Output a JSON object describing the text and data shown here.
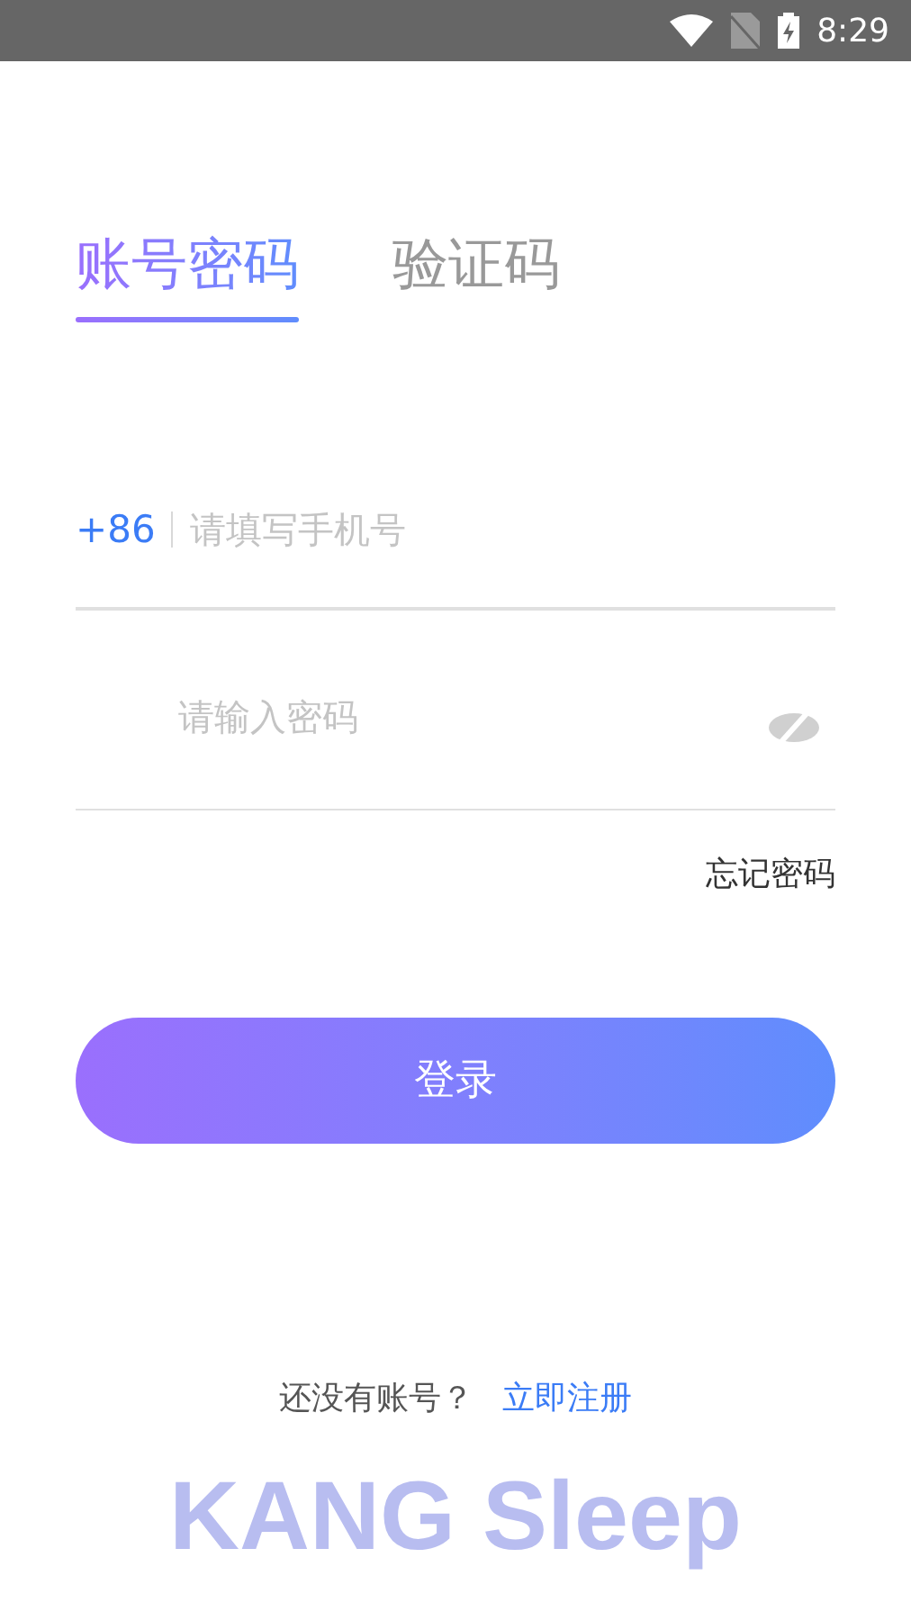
{
  "status_bar": {
    "time": "8:29"
  },
  "tabs": [
    {
      "label": "账号密码",
      "selected": true
    },
    {
      "label": "验证码",
      "selected": false
    }
  ],
  "phone": {
    "prefix": "+86",
    "placeholder": "请填写手机号"
  },
  "password": {
    "placeholder": "请输入密码",
    "visible": false
  },
  "forgot_link": "忘记密码",
  "login_button": "登录",
  "register": {
    "prompt": "还没有账号？",
    "link": "立即注册"
  },
  "brand": "KANG Sleep"
}
